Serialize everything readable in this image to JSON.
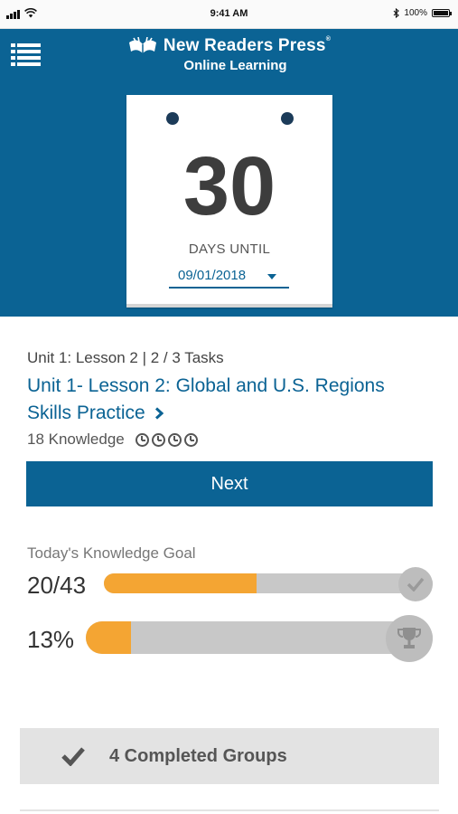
{
  "status_bar": {
    "time": "9:41 AM",
    "battery_text": "100%",
    "icons": [
      "signal-icon",
      "wifi-icon",
      "bluetooth-icon",
      "battery-icon"
    ]
  },
  "header": {
    "menu_icon": "hamburger-menu-icon",
    "brand_title": "New Readers Press",
    "brand_reg": "®",
    "brand_subtitle": "Online Learning",
    "colors": {
      "header_bg": "#0b6394"
    }
  },
  "countdown": {
    "days": "30",
    "label": "DAYS UNTIL",
    "date": "09/01/2018"
  },
  "lesson": {
    "meta": "Unit 1: Lesson 2 | 2 / 3 Tasks",
    "title": "Unit 1- Lesson 2: Global and U.S. Regions Skills Practice",
    "knowledge": "18 Knowledge",
    "clock_count": 4,
    "next_label": "Next"
  },
  "goal": {
    "label": "Today's Knowledge Goal",
    "knowledge_text": "20/43",
    "knowledge_progress": 0.465,
    "percent_text": "13%",
    "percent_progress": 0.13,
    "colors": {
      "fill": "#f4a533",
      "track": "#c8c8c8"
    }
  },
  "completed": {
    "label": "4 Completed Groups"
  }
}
